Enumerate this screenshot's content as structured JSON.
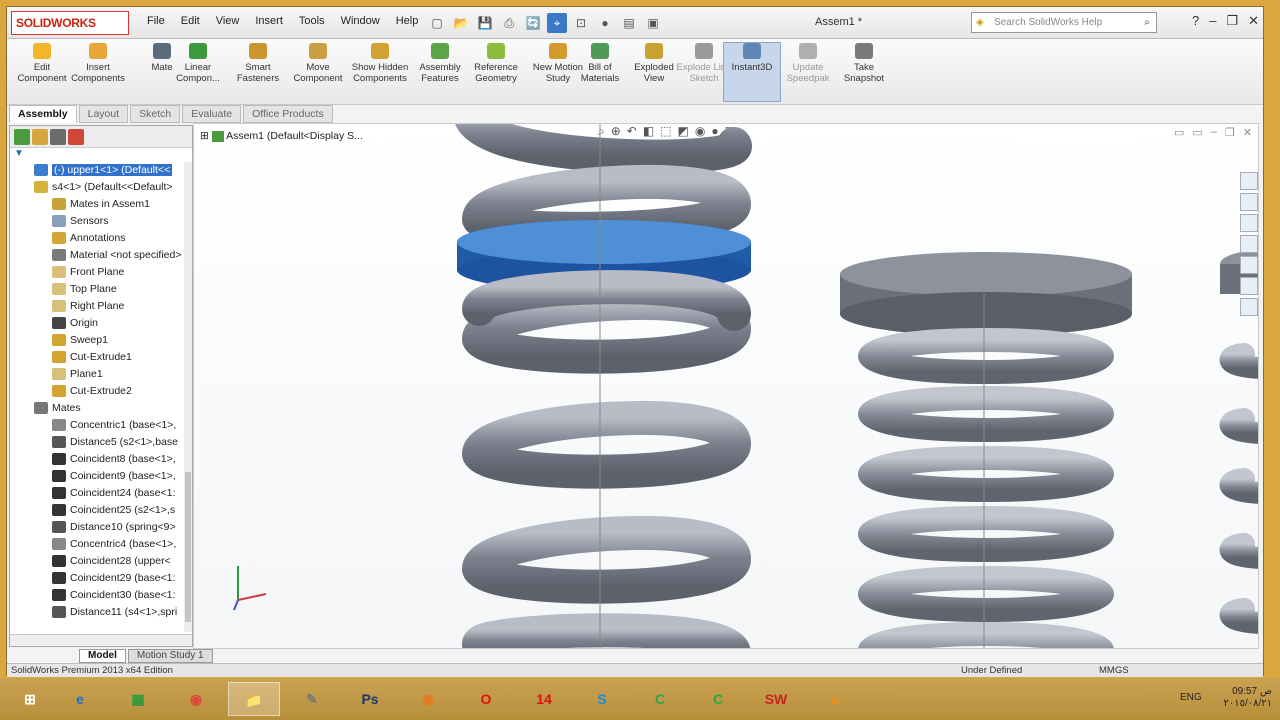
{
  "app": {
    "logo": "SOLIDWORKS",
    "doc_title": "Assem1 *"
  },
  "menu": [
    "File",
    "Edit",
    "View",
    "Insert",
    "Tools",
    "Window",
    "Help"
  ],
  "search": {
    "placeholder": "Search SolidWorks Help"
  },
  "commands": [
    {
      "label": "Edit Component",
      "color": "#f1b62a"
    },
    {
      "label": "Insert Components",
      "color": "#e7a63a"
    },
    {
      "label": "Mate",
      "color": "#5b6b7a"
    },
    {
      "label": "Linear Compon...",
      "color": "#3b9a3b"
    },
    {
      "label": "Smart Fasteners",
      "color": "#c9952c"
    },
    {
      "label": "Move Component",
      "color": "#caa040"
    },
    {
      "label": "Show Hidden Components",
      "color": "#d2a233"
    },
    {
      "label": "Assembly Features",
      "color": "#5ca34a"
    },
    {
      "label": "Reference Geometry",
      "color": "#8cbc3c"
    },
    {
      "label": "New Motion Study",
      "color": "#d39a2e"
    },
    {
      "label": "Bill of Materials",
      "color": "#4f9b55"
    },
    {
      "label": "Exploded View",
      "color": "#c8a233"
    },
    {
      "label": "Explode Line Sketch",
      "color": "#9a9a9a"
    },
    {
      "label": "Instant3D",
      "color": "#5f87b5"
    },
    {
      "label": "Update Speedpak",
      "color": "#b0b0b0"
    },
    {
      "label": "Take Snapshot",
      "color": "#7a7a7a"
    }
  ],
  "tabs": [
    "Assembly",
    "Layout",
    "Sketch",
    "Evaluate",
    "Office Products"
  ],
  "tree": {
    "root": "Assem1  (Default<Display S...",
    "items": [
      {
        "label": "(-) upper1<1> (Default<<",
        "indent": 0,
        "color": "#3b7bd0",
        "selected": true
      },
      {
        "label": "s4<1> (Default<<Default>",
        "indent": 0,
        "color": "#d7b23a"
      },
      {
        "label": "Mates in Assem1",
        "indent": 1,
        "color": "#c9a33a"
      },
      {
        "label": "Sensors",
        "indent": 1,
        "color": "#8aa0b8"
      },
      {
        "label": "Annotations",
        "indent": 1,
        "color": "#d2a638"
      },
      {
        "label": "Material <not specified>",
        "indent": 1,
        "color": "#7a7a7a"
      },
      {
        "label": "Front Plane",
        "indent": 1,
        "color": "#d9c07a"
      },
      {
        "label": "Top Plane",
        "indent": 1,
        "color": "#d9c07a"
      },
      {
        "label": "Right Plane",
        "indent": 1,
        "color": "#d9c07a"
      },
      {
        "label": "Origin",
        "indent": 1,
        "color": "#444"
      },
      {
        "label": "Sweep1",
        "indent": 1,
        "color": "#d3a432"
      },
      {
        "label": "Cut-Extrude1",
        "indent": 1,
        "color": "#d3a432"
      },
      {
        "label": "Plane1",
        "indent": 1,
        "color": "#d9c07a"
      },
      {
        "label": "Cut-Extrude2",
        "indent": 1,
        "color": "#d3a432"
      },
      {
        "label": "Mates",
        "indent": 0,
        "color": "#777"
      },
      {
        "label": "Concentric1 (base<1>,",
        "indent": 1,
        "color": "#888"
      },
      {
        "label": "Distance5 (s2<1>,base",
        "indent": 1,
        "color": "#555"
      },
      {
        "label": "Coincident8 (base<1>,",
        "indent": 1,
        "color": "#333"
      },
      {
        "label": "Coincident9 (base<1>,",
        "indent": 1,
        "color": "#333"
      },
      {
        "label": "Coincident24 (base<1:",
        "indent": 1,
        "color": "#333"
      },
      {
        "label": "Coincident25 (s2<1>,s",
        "indent": 1,
        "color": "#333"
      },
      {
        "label": "Distance10 (spring<9>",
        "indent": 1,
        "color": "#555"
      },
      {
        "label": "Concentric4 (base<1>,",
        "indent": 1,
        "color": "#888"
      },
      {
        "label": "Coincident28 (upper<",
        "indent": 1,
        "color": "#333"
      },
      {
        "label": "Coincident29 (base<1:",
        "indent": 1,
        "color": "#333"
      },
      {
        "label": "Coincident30 (base<1:",
        "indent": 1,
        "color": "#333"
      },
      {
        "label": "Distance11 (s4<1>,spri",
        "indent": 1,
        "color": "#555"
      }
    ]
  },
  "bottom_tabs": [
    "Model",
    "Motion Study 1"
  ],
  "status": {
    "edition": "SolidWorks Premium 2013 x64 Edition",
    "state": "Under Defined",
    "units": "MMGS"
  },
  "taskbar": {
    "apps": [
      "e",
      "▦",
      "◉",
      "📁",
      "✎",
      "Ps",
      "◉",
      "O",
      "14",
      "S",
      "C",
      "C",
      "SW",
      "▲"
    ],
    "lang": "ENG",
    "time": "09:57 ص",
    "date": "٢٠١٥/٠٨/٢١"
  }
}
